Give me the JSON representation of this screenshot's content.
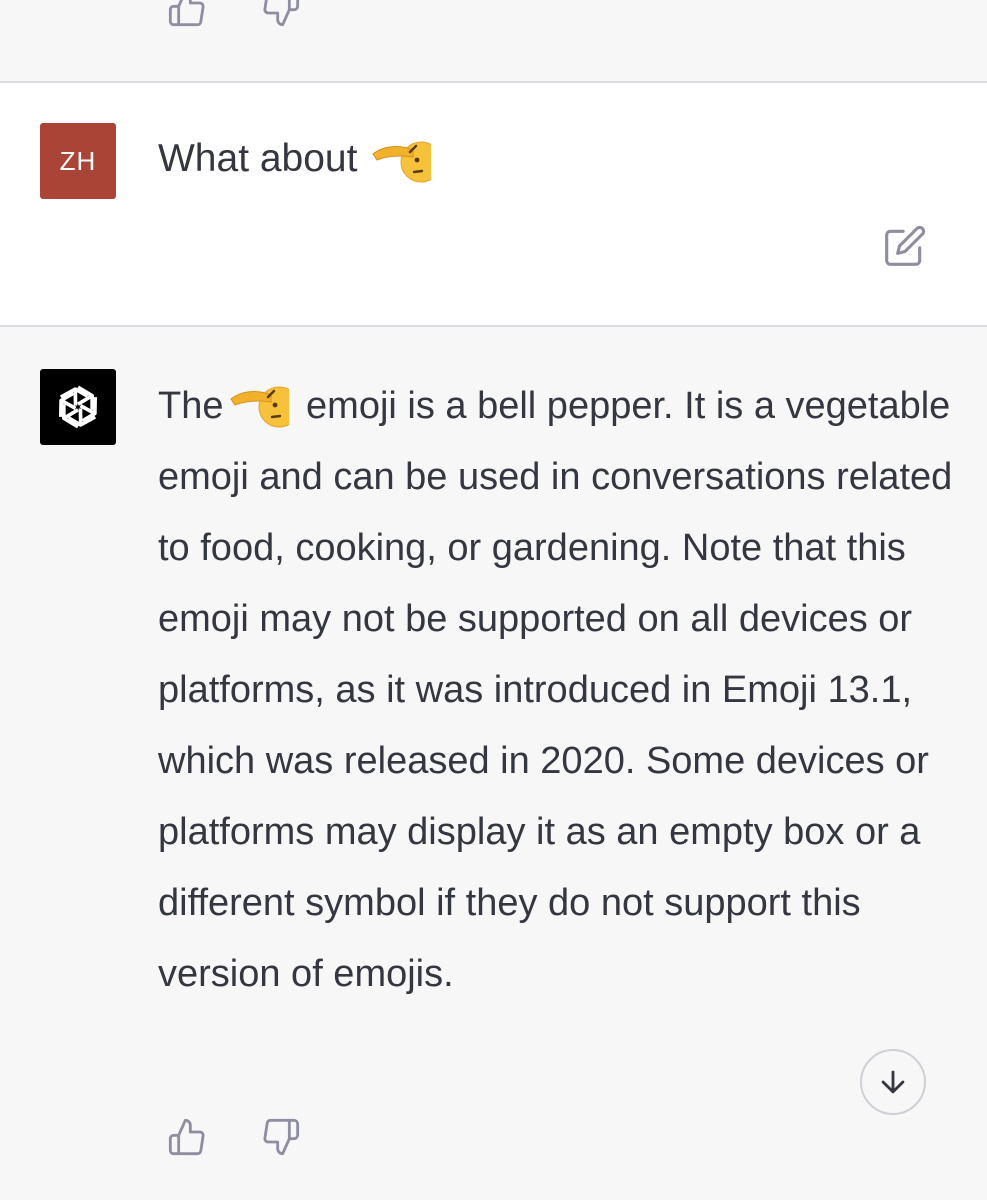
{
  "previous_message": {
    "actions": [
      {
        "name": "thumbs-up-icon",
        "label": "Like"
      },
      {
        "name": "thumbs-down-icon",
        "label": "Dislike"
      }
    ]
  },
  "user_message": {
    "avatar_initials": "ZH",
    "avatar_color": "#a94437",
    "text": "What about",
    "emoji": "saluting-face-emoji",
    "edit_icon": "edit-icon"
  },
  "assistant_message": {
    "avatar_icon": "openai-logo-icon",
    "avatar_color": "#000000",
    "text_before_emoji": "The",
    "emoji": "saluting-face-emoji",
    "text_after_emoji": "emoji is a bell pepper. It is a vegetable emoji and can be used in conversations related to food, cooking, or gardening. Note that this emoji may not be supported on all devices or platforms, as it was introduced in Emoji 13.1, which was released in 2020. Some devices or platforms may display it as an empty box or a different symbol if they do not support this version of emojis.",
    "scroll_icon": "arrow-down-icon",
    "actions": [
      {
        "name": "thumbs-up-icon",
        "label": "Like"
      },
      {
        "name": "thumbs-down-icon",
        "label": "Dislike"
      }
    ]
  },
  "colors": {
    "user_bg": "#ffffff",
    "assistant_bg": "#f7f7f8",
    "text": "#353740",
    "icon": "#8e8ea0"
  }
}
